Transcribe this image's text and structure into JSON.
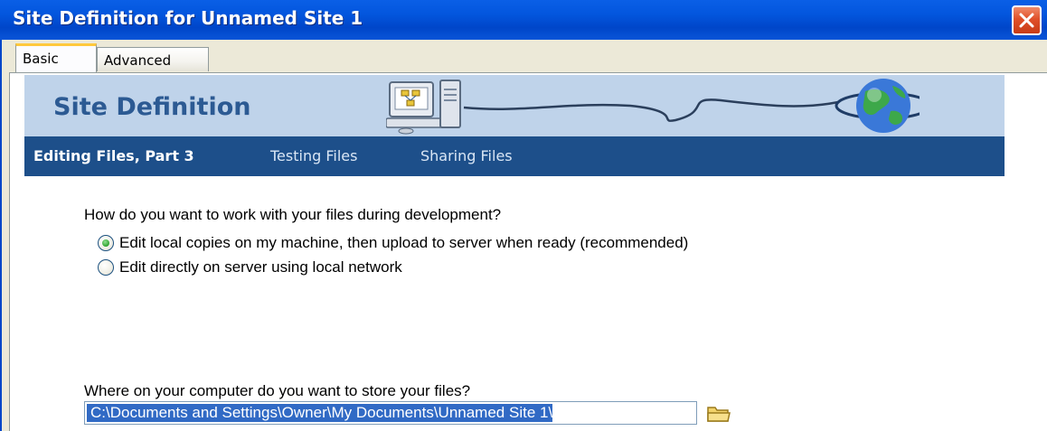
{
  "window": {
    "title": "Site Definition for Unnamed Site 1"
  },
  "tabs": [
    {
      "label": "Basic",
      "active": true
    },
    {
      "label": "Advanced",
      "active": false
    }
  ],
  "banner": {
    "title": "Site Definition"
  },
  "steps": [
    {
      "label": "Editing Files, Part 3",
      "current": true
    },
    {
      "label": "Testing Files",
      "current": false
    },
    {
      "label": "Sharing Files",
      "current": false
    }
  ],
  "form": {
    "work_question": "How do you want to work with your files during development?",
    "work_options": [
      {
        "label": "Edit local copies on my machine, then upload to server when ready (recommended)",
        "selected": true
      },
      {
        "label": "Edit directly on server using local network",
        "selected": false
      }
    ],
    "store_question": "Where on your computer do you want to store your files?",
    "store_path": "C:\\Documents and Settings\\Owner\\My Documents\\Unnamed Site 1\\"
  },
  "icons": {
    "close": "close-icon",
    "folder": "folder-icon",
    "computer": "computer-icon",
    "globe": "globe-icon"
  },
  "colors": {
    "titlebar": "#0356de",
    "banner": "#bfd3ea",
    "stepbar": "#1d4f8a",
    "banner_title": "#2c5a93",
    "selection": "#316ac5"
  }
}
